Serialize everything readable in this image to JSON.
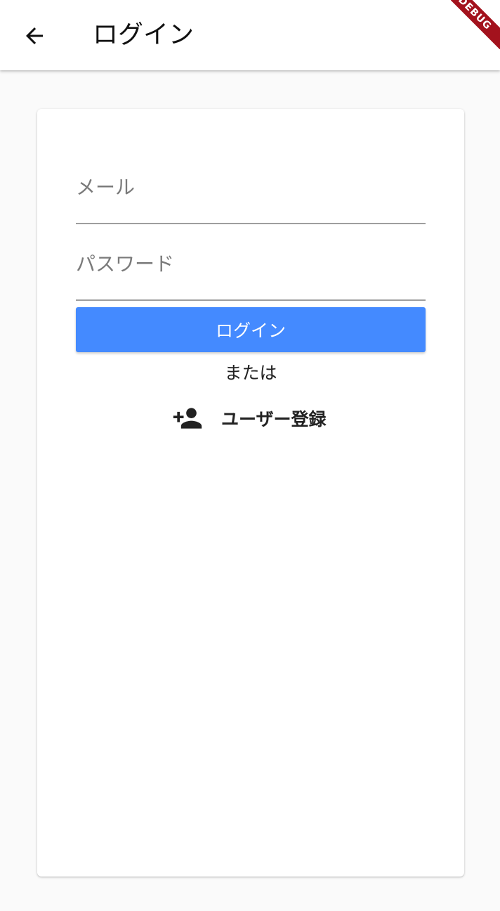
{
  "app_bar": {
    "title": "ログイン",
    "back_icon": "arrow-left-icon"
  },
  "debug_banner": {
    "text": "DEBUG"
  },
  "form": {
    "email_placeholder": "メール",
    "email_value": "",
    "password_placeholder": "パスワード",
    "password_value": "",
    "login_button_label": "ログイン",
    "or_text": "または",
    "register_label": "ユーザー登録",
    "register_icon": "person-add-icon"
  },
  "colors": {
    "primary_button": "#448aff",
    "debug_banner": "#a3121d",
    "background": "#fafafa",
    "card": "#ffffff"
  }
}
